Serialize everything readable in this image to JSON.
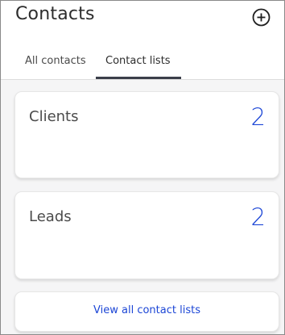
{
  "header": {
    "title": "Contacts",
    "add_icon": "plus-circle-icon"
  },
  "tabs": [
    {
      "label": "All contacts",
      "active": false
    },
    {
      "label": "Contact lists",
      "active": true
    }
  ],
  "lists": [
    {
      "name": "Clients",
      "count": "2"
    },
    {
      "name": "Leads",
      "count": "2"
    }
  ],
  "footer": {
    "view_all_label": "View all contact lists"
  },
  "colors": {
    "accent": "#1c46d6",
    "tab_underline": "#3b3f4a",
    "background": "#f5f5f6"
  }
}
